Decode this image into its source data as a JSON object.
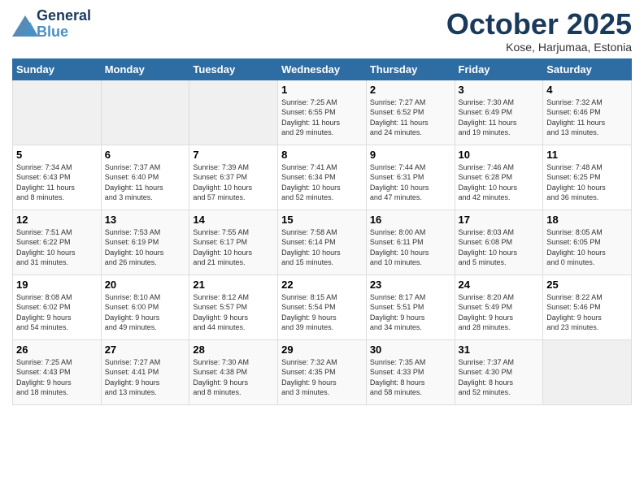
{
  "logo": {
    "line1": "General",
    "line2": "Blue"
  },
  "title": "October 2025",
  "location": "Kose, Harjumaa, Estonia",
  "days_of_week": [
    "Sunday",
    "Monday",
    "Tuesday",
    "Wednesday",
    "Thursday",
    "Friday",
    "Saturday"
  ],
  "weeks": [
    [
      {
        "day": "",
        "info": ""
      },
      {
        "day": "",
        "info": ""
      },
      {
        "day": "",
        "info": ""
      },
      {
        "day": "1",
        "info": "Sunrise: 7:25 AM\nSunset: 6:55 PM\nDaylight: 11 hours\nand 29 minutes."
      },
      {
        "day": "2",
        "info": "Sunrise: 7:27 AM\nSunset: 6:52 PM\nDaylight: 11 hours\nand 24 minutes."
      },
      {
        "day": "3",
        "info": "Sunrise: 7:30 AM\nSunset: 6:49 PM\nDaylight: 11 hours\nand 19 minutes."
      },
      {
        "day": "4",
        "info": "Sunrise: 7:32 AM\nSunset: 6:46 PM\nDaylight: 11 hours\nand 13 minutes."
      }
    ],
    [
      {
        "day": "5",
        "info": "Sunrise: 7:34 AM\nSunset: 6:43 PM\nDaylight: 11 hours\nand 8 minutes."
      },
      {
        "day": "6",
        "info": "Sunrise: 7:37 AM\nSunset: 6:40 PM\nDaylight: 11 hours\nand 3 minutes."
      },
      {
        "day": "7",
        "info": "Sunrise: 7:39 AM\nSunset: 6:37 PM\nDaylight: 10 hours\nand 57 minutes."
      },
      {
        "day": "8",
        "info": "Sunrise: 7:41 AM\nSunset: 6:34 PM\nDaylight: 10 hours\nand 52 minutes."
      },
      {
        "day": "9",
        "info": "Sunrise: 7:44 AM\nSunset: 6:31 PM\nDaylight: 10 hours\nand 47 minutes."
      },
      {
        "day": "10",
        "info": "Sunrise: 7:46 AM\nSunset: 6:28 PM\nDaylight: 10 hours\nand 42 minutes."
      },
      {
        "day": "11",
        "info": "Sunrise: 7:48 AM\nSunset: 6:25 PM\nDaylight: 10 hours\nand 36 minutes."
      }
    ],
    [
      {
        "day": "12",
        "info": "Sunrise: 7:51 AM\nSunset: 6:22 PM\nDaylight: 10 hours\nand 31 minutes."
      },
      {
        "day": "13",
        "info": "Sunrise: 7:53 AM\nSunset: 6:19 PM\nDaylight: 10 hours\nand 26 minutes."
      },
      {
        "day": "14",
        "info": "Sunrise: 7:55 AM\nSunset: 6:17 PM\nDaylight: 10 hours\nand 21 minutes."
      },
      {
        "day": "15",
        "info": "Sunrise: 7:58 AM\nSunset: 6:14 PM\nDaylight: 10 hours\nand 15 minutes."
      },
      {
        "day": "16",
        "info": "Sunrise: 8:00 AM\nSunset: 6:11 PM\nDaylight: 10 hours\nand 10 minutes."
      },
      {
        "day": "17",
        "info": "Sunrise: 8:03 AM\nSunset: 6:08 PM\nDaylight: 10 hours\nand 5 minutes."
      },
      {
        "day": "18",
        "info": "Sunrise: 8:05 AM\nSunset: 6:05 PM\nDaylight: 10 hours\nand 0 minutes."
      }
    ],
    [
      {
        "day": "19",
        "info": "Sunrise: 8:08 AM\nSunset: 6:02 PM\nDaylight: 9 hours\nand 54 minutes."
      },
      {
        "day": "20",
        "info": "Sunrise: 8:10 AM\nSunset: 6:00 PM\nDaylight: 9 hours\nand 49 minutes."
      },
      {
        "day": "21",
        "info": "Sunrise: 8:12 AM\nSunset: 5:57 PM\nDaylight: 9 hours\nand 44 minutes."
      },
      {
        "day": "22",
        "info": "Sunrise: 8:15 AM\nSunset: 5:54 PM\nDaylight: 9 hours\nand 39 minutes."
      },
      {
        "day": "23",
        "info": "Sunrise: 8:17 AM\nSunset: 5:51 PM\nDaylight: 9 hours\nand 34 minutes."
      },
      {
        "day": "24",
        "info": "Sunrise: 8:20 AM\nSunset: 5:49 PM\nDaylight: 9 hours\nand 28 minutes."
      },
      {
        "day": "25",
        "info": "Sunrise: 8:22 AM\nSunset: 5:46 PM\nDaylight: 9 hours\nand 23 minutes."
      }
    ],
    [
      {
        "day": "26",
        "info": "Sunrise: 7:25 AM\nSunset: 4:43 PM\nDaylight: 9 hours\nand 18 minutes."
      },
      {
        "day": "27",
        "info": "Sunrise: 7:27 AM\nSunset: 4:41 PM\nDaylight: 9 hours\nand 13 minutes."
      },
      {
        "day": "28",
        "info": "Sunrise: 7:30 AM\nSunset: 4:38 PM\nDaylight: 9 hours\nand 8 minutes."
      },
      {
        "day": "29",
        "info": "Sunrise: 7:32 AM\nSunset: 4:35 PM\nDaylight: 9 hours\nand 3 minutes."
      },
      {
        "day": "30",
        "info": "Sunrise: 7:35 AM\nSunset: 4:33 PM\nDaylight: 8 hours\nand 58 minutes."
      },
      {
        "day": "31",
        "info": "Sunrise: 7:37 AM\nSunset: 4:30 PM\nDaylight: 8 hours\nand 52 minutes."
      },
      {
        "day": "",
        "info": ""
      }
    ]
  ]
}
